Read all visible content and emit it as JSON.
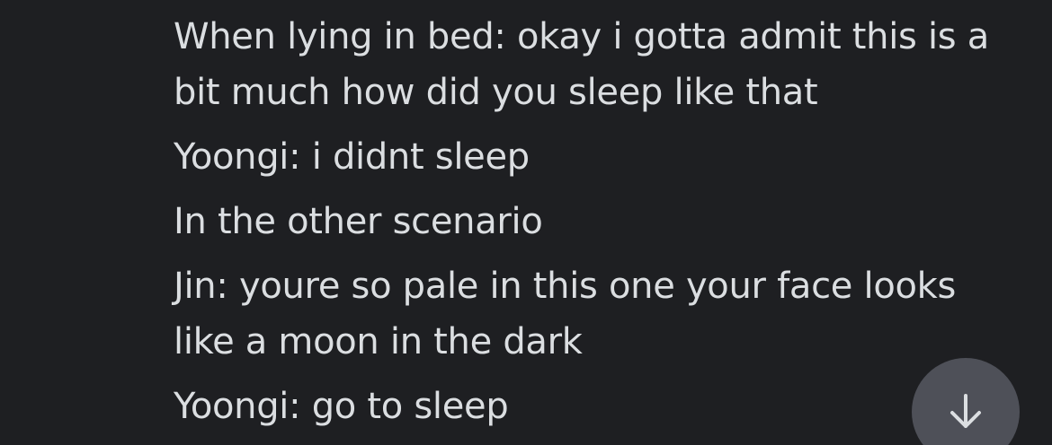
{
  "messages": [
    {
      "text": "When lying in bed: okay i gotta admit this is a bit much how did you sleep like that"
    },
    {
      "text": "Yoongi: i didnt sleep"
    },
    {
      "text": "In the other scenario"
    },
    {
      "text": "Jin: youre so pale in this one your face looks like a moon in the dark"
    },
    {
      "text": "Yoongi: go to sleep"
    }
  ],
  "scroll_button": {
    "icon": "arrow-down-icon"
  },
  "colors": {
    "background": "#1e1f22",
    "text": "#dbdee1",
    "button": "#4e5058"
  }
}
